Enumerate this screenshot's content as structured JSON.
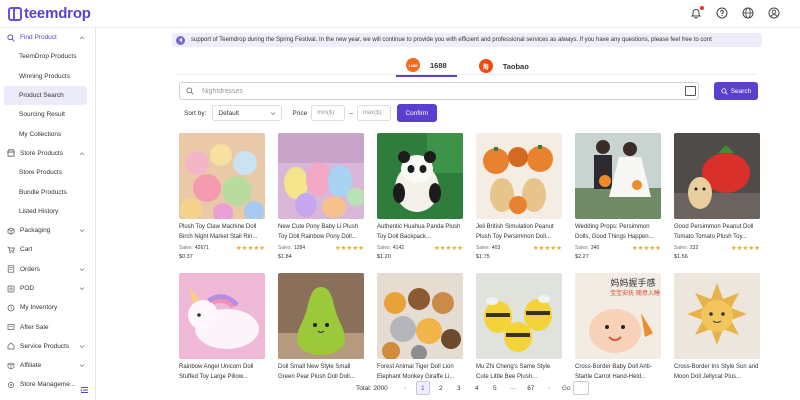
{
  "app": {
    "logo_text": "teemdrop"
  },
  "topbar": {
    "icons": [
      "bell-icon",
      "help-icon",
      "globe-icon",
      "user-icon"
    ]
  },
  "sidebar": {
    "groups": [
      {
        "label": "Find Product",
        "icon": "search-icon",
        "expanded": true,
        "items": [
          "TeemDrop Products",
          "Winning Products",
          "Product Search",
          "Sourcing Result",
          "My Collections"
        ]
      },
      {
        "label": "Store Products",
        "icon": "store-icon",
        "expanded": true,
        "items": [
          "Store Products",
          "Bundle Products",
          "Listed History"
        ]
      },
      {
        "label": "Packaging",
        "icon": "box-icon"
      },
      {
        "label": "Cart",
        "icon": "cart-icon"
      },
      {
        "label": "Orders",
        "icon": "orders-icon"
      },
      {
        "label": "POD",
        "icon": "pod-icon"
      },
      {
        "label": "My Inventory",
        "icon": "inventory-icon"
      },
      {
        "label": "After Sale",
        "icon": "after-sale-icon"
      },
      {
        "label": "Service Products",
        "icon": "service-icon"
      },
      {
        "label": "Affiliate",
        "icon": "affiliate-icon"
      },
      {
        "label": "Store Manageme...",
        "icon": "store-manage-icon"
      }
    ],
    "active_item": "Product Search"
  },
  "notice": {
    "text": "support of Teemdrop during the Spring Festival. In the new year, we will continue to provide you with efficient and professional services as always. If you have any questions, please feel free to cont"
  },
  "tabs": [
    {
      "label": "1688",
      "badge": "1688",
      "active": true
    },
    {
      "label": "Taobao",
      "badge": "淘",
      "active": false
    }
  ],
  "search": {
    "placeholder": "Nightdresses",
    "button_label": "Search"
  },
  "filters": {
    "sort_label": "Sort by:",
    "sort_value": "Default",
    "price_label": "Price",
    "min_placeholder": "min($)",
    "max_placeholder": "max($)",
    "dash": "–",
    "confirm_label": "Confirm"
  },
  "products": [
    {
      "title": "Plush Toy Claw Machine Doll Birch Night Market Stall Rin...",
      "sales_label": "Sales:",
      "sales": "42671",
      "stars": "★★★★★",
      "price": "$0.37"
    },
    {
      "title": "New Cute Pony Baby Li Plush Toy Doll Rainbow Pony Doll...",
      "sales_label": "Sales:",
      "sales": "1284",
      "stars": "★★★★★",
      "price": "$1.84"
    },
    {
      "title": "Authentic Huahua Panda Plush Toy Doll Backpack...",
      "sales_label": "Sales:",
      "sales": "4142",
      "stars": "★★★★★",
      "price": "$1.20"
    },
    {
      "title": "Jeli British Simulation Peanut Plush Toy Persimmon Doll...",
      "sales_label": "Sales:",
      "sales": "403",
      "stars": "★★★★★",
      "price": "$1.75"
    },
    {
      "title": "Wedding Props: Persimmon Dolls, Good Things Happen...",
      "sales_label": "Sales:",
      "sales": "340",
      "stars": "★★★★★",
      "price": "$2.27"
    },
    {
      "title": "Good Persimmon Peanut Doll Tomato Tomato Plush Toy...",
      "sales_label": "Sales:",
      "sales": "232",
      "stars": "★★★★★",
      "price": "$1.56"
    },
    {
      "title": "Rainbow Angel Unicorn Doll Stuffed Toy Large Pillow..."
    },
    {
      "title": "Doll Small New Style Small Green Pear Plush Doll Doll..."
    },
    {
      "title": "Forest Animal Tiger Doll Lion Elephant Monkey Giraffe Li..."
    },
    {
      "title": "Mu Zhi Cheng's Same Style Cute Little Bee Plush..."
    },
    {
      "title": "Cross-Border Baby Doll Anti-Startle Carrot Hand-Held..."
    },
    {
      "title": "Cross-Border Ins Style Sun and Moon Doll Jellycat Plus..."
    }
  ],
  "pagination": {
    "total": "Total: 2000",
    "prev": "‹",
    "pages": [
      "1",
      "2",
      "3",
      "4",
      "5",
      "···",
      "67"
    ],
    "next": "›",
    "goto": "Go",
    "current": "1"
  },
  "colors": {
    "accent": "#5b3fd0",
    "notice_bg": "#eeeefa",
    "star": "#f5a623"
  }
}
